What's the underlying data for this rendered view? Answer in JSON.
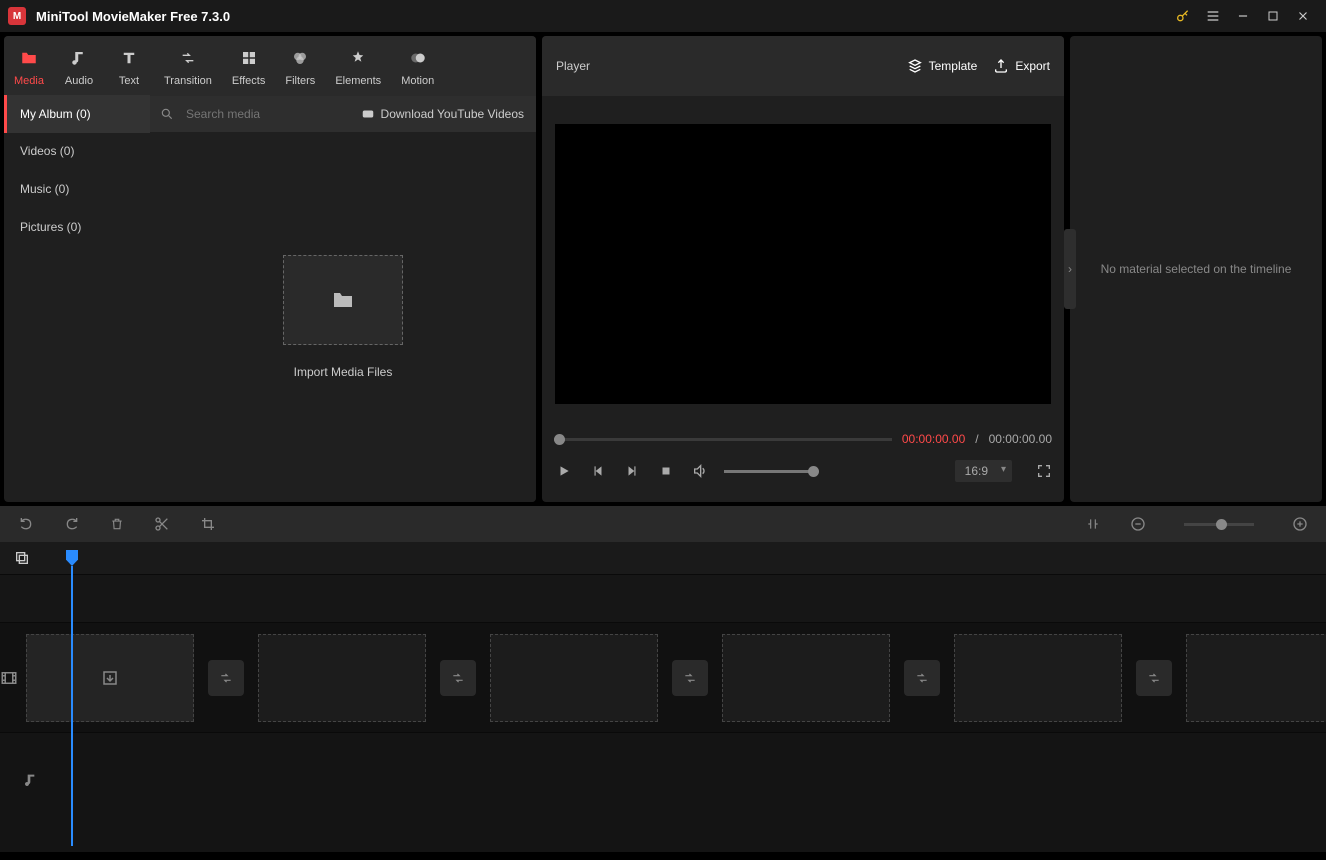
{
  "titlebar": {
    "app_title": "MiniTool MovieMaker Free 7.3.0"
  },
  "tabs": [
    {
      "label": "Media"
    },
    {
      "label": "Audio"
    },
    {
      "label": "Text"
    },
    {
      "label": "Transition"
    },
    {
      "label": "Effects"
    },
    {
      "label": "Filters"
    },
    {
      "label": "Elements"
    },
    {
      "label": "Motion"
    }
  ],
  "sidebar": {
    "items": [
      {
        "label": "My Album (0)"
      },
      {
        "label": "Videos (0)"
      },
      {
        "label": "Music (0)"
      },
      {
        "label": "Pictures (0)"
      }
    ]
  },
  "search": {
    "placeholder": "Search media"
  },
  "download_yt": "Download YouTube Videos",
  "import_label": "Import Media Files",
  "player": {
    "title": "Player",
    "template": "Template",
    "export": "Export",
    "time_current": "00:00:00.00",
    "time_sep": "/",
    "time_total": "00:00:00.00",
    "ratio": "16:9"
  },
  "right_panel_msg": "No material selected on the timeline"
}
